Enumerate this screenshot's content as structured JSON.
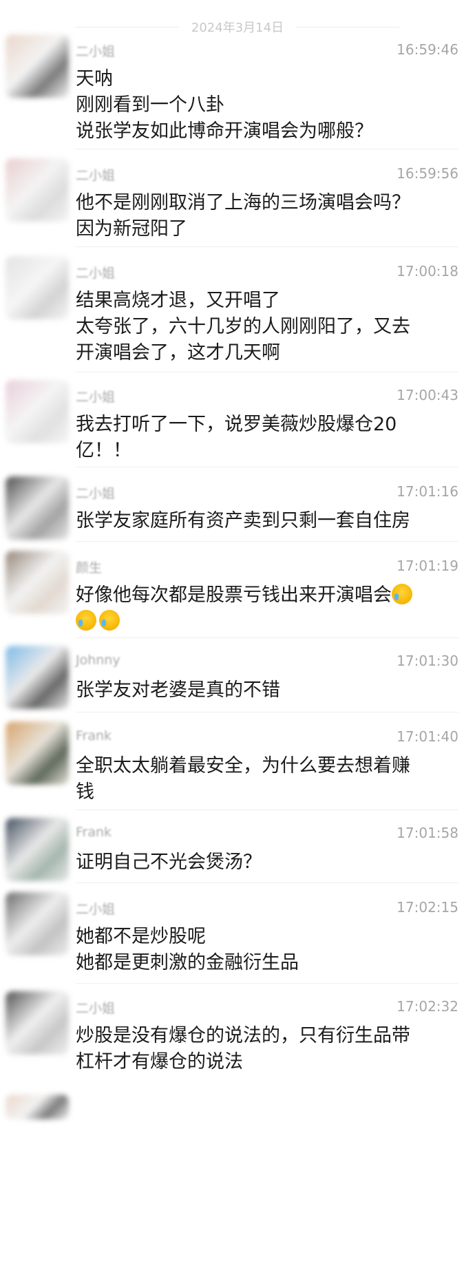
{
  "date_divider": "2024年3月14日",
  "messages": [
    {
      "sender": "二小姐",
      "time": "16:59:46",
      "lines": [
        "天呐",
        "刚刚看到一个八卦",
        "说张学友如此博命开演唱会为哪般？"
      ]
    },
    {
      "sender": "二小姐",
      "time": "16:59:56",
      "lines": [
        "他不是刚刚取消了上海的三场演唱会吗？",
        "因为新冠阳了"
      ]
    },
    {
      "sender": "二小姐",
      "time": "17:00:18",
      "lines": [
        "结果高烧才退，又开唱了",
        "太夸张了，六十几岁的人刚刚阳了，又去",
        "开演唱会了，这才几天啊"
      ]
    },
    {
      "sender": "二小姐",
      "time": "17:00:43",
      "lines": [
        "我去打听了一下，说罗美薇炒股爆仓20",
        "亿！！"
      ]
    },
    {
      "sender": "二小姐",
      "time": "17:01:16",
      "lines": [
        "张学友家庭所有资产卖到只剩一套自住房"
      ]
    },
    {
      "sender": "颜生",
      "time": "17:01:19",
      "lines": [
        "好像他每次都是股票亏钱出来开演唱会",
        ""
      ],
      "emojis": [
        "loudly-crying-emoji",
        "loudly-crying-emoji",
        "loudly-crying-emoji"
      ]
    },
    {
      "sender": "Johnny",
      "time": "17:01:30",
      "lines": [
        "张学友对老婆是真的不错"
      ]
    },
    {
      "sender": "Frank",
      "time": "17:01:40",
      "lines": [
        "全职太太躺着最安全，为什么要去想着赚",
        "钱"
      ]
    },
    {
      "sender": "Frank",
      "time": "17:01:58",
      "lines": [
        "证明自己不光会煲汤？"
      ]
    },
    {
      "sender": "二小姐",
      "time": "17:02:15",
      "lines": [
        "她都不是炒股呢",
        "她都是更刺激的金融衍生品"
      ]
    },
    {
      "sender": "二小姐",
      "time": "17:02:32",
      "lines": [
        "炒股是没有爆仓的说法的，只有衍生品带",
        "杠杆才有爆仓的说法"
      ]
    }
  ],
  "avatar_colors": [
    [
      "#e9d3c6",
      "#6f6f6f",
      "#f2f2f2"
    ],
    [
      "#e8c9c9",
      "#d9d9d9",
      "#f3f3f3"
    ],
    [
      "#e0e0e0",
      "#cfcfcf",
      "#f5f5f5"
    ],
    [
      "#e7c9d6",
      "#dedede",
      "#f4f4f4"
    ],
    [
      "#3c3c3c",
      "#9a9a9a",
      "#e5e5e5"
    ],
    [
      "#8a7a6b",
      "#e0d6cc",
      "#f2f2f2"
    ],
    [
      "#6fb3e6",
      "#5a5a5a",
      "#e8e8e8"
    ],
    [
      "#d39a5c",
      "#4e5a4a",
      "#e6e0d6"
    ],
    [
      "#2f3d4f",
      "#9cb0a6",
      "#e6e6e6"
    ],
    [
      "#5c5c5c",
      "#bdbdbd",
      "#ededed"
    ],
    [
      "#3f3f3f",
      "#c2c2c2",
      "#efefef"
    ]
  ]
}
